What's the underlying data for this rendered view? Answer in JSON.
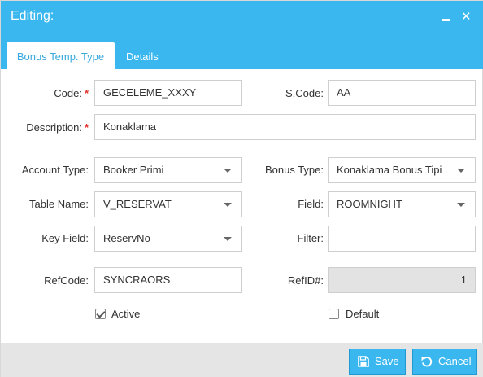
{
  "window": {
    "title": "Editing:"
  },
  "tabs": [
    {
      "label": "Bonus Temp. Type"
    },
    {
      "label": "Details"
    }
  ],
  "form": {
    "code": {
      "label": "Code:",
      "value": "GECELEME_XXXY",
      "required": "*"
    },
    "scode": {
      "label": "S.Code:",
      "value": "AA"
    },
    "description": {
      "label": "Description:",
      "value": "Konaklama",
      "required": "*"
    },
    "account_type": {
      "label": "Account Type:",
      "value": "Booker Primi"
    },
    "bonus_type": {
      "label": "Bonus Type:",
      "value": "Konaklama Bonus Tipi"
    },
    "table_name": {
      "label": "Table Name:",
      "value": "V_RESERVAT"
    },
    "field": {
      "label": "Field:",
      "value": "ROOMNIGHT"
    },
    "key_field": {
      "label": "Key Field:",
      "value": "ReservNo"
    },
    "filter": {
      "label": "Filter:",
      "value": ""
    },
    "refcode": {
      "label": "RefCode:",
      "value": "SYNCRAORS"
    },
    "refid": {
      "label": "RefID#:",
      "value": "1"
    },
    "active": {
      "label": "Active",
      "checked": true
    },
    "default": {
      "label": "Default",
      "checked": false
    }
  },
  "buttons": {
    "save": "Save",
    "cancel": "Cancel"
  },
  "colors": {
    "accent": "#39b7ee",
    "required": "#e0322b",
    "footer": "#e5e5e5"
  }
}
